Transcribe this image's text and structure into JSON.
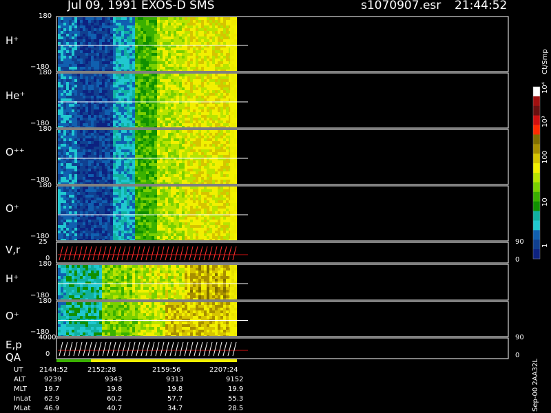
{
  "header": {
    "title": "Jul 09, 1991    EXOS-D SMS",
    "file": "s1070907.esr",
    "time": "21:44:52"
  },
  "colorbar": {
    "title": "Ct/Smp",
    "labels": [
      "10⁴",
      "10³",
      "100",
      "10",
      "1"
    ],
    "colors": [
      "#ffffff",
      "#a01010",
      "#6a1010",
      "#d01010",
      "#ff2a00",
      "#806e00",
      "#a88f00",
      "#d6c400",
      "#f2f000",
      "#b8e400",
      "#7ad000",
      "#3ab000",
      "#109000",
      "#10b0a0",
      "#20c8d0",
      "#1060b0",
      "#104090",
      "#0d2280"
    ]
  },
  "side_label": "Sep-00  2AA32L",
  "chart_data": [
    {
      "type": "heatmap",
      "title": "H⁺",
      "ylim": [
        -180,
        180
      ],
      "yticks": [
        "180",
        "−180"
      ],
      "line_value": 0
    },
    {
      "type": "heatmap",
      "title": "He⁺",
      "ylim": [
        -180,
        180
      ],
      "yticks": [
        "180",
        "−180"
      ],
      "line_value": 0
    },
    {
      "type": "heatmap",
      "title": "O⁺⁺",
      "ylim": [
        -180,
        180
      ],
      "yticks": [
        "180",
        "−180"
      ],
      "line_value": 0
    },
    {
      "type": "heatmap",
      "title": "O⁺",
      "ylim": [
        -180,
        180
      ],
      "yticks": [
        "180",
        "−180"
      ],
      "line_value": 0
    },
    {
      "type": "line",
      "title": "V,r",
      "ylim": [
        0,
        25
      ],
      "yticks": [
        "25",
        "0"
      ],
      "right_ticks": [
        "90",
        "0"
      ]
    },
    {
      "type": "heatmap",
      "title": "H⁺",
      "ylim": [
        -180,
        180
      ],
      "yticks": [
        "180",
        "−180"
      ],
      "line_value": 0
    },
    {
      "type": "heatmap",
      "title": "O⁺",
      "ylim": [
        -180,
        180
      ],
      "yticks": [
        "180",
        "−180"
      ],
      "line_value": 0
    },
    {
      "type": "line",
      "title": "E,p",
      "ylim": [
        0,
        4000
      ],
      "yticks": [
        "4000",
        "0"
      ],
      "right_ticks": [
        "90",
        "0"
      ]
    }
  ],
  "qa_label": "QA",
  "footer": {
    "labels": [
      "UT",
      "ALT",
      "MLT",
      "InLat",
      "MLat"
    ],
    "columns": [
      [
        "2144:52",
        "9239",
        "19.7",
        "62.9",
        "46.9"
      ],
      [
        "2152:28",
        "9343",
        "19.8",
        "60.2",
        "40.7"
      ],
      [
        "2159:56",
        "9313",
        "19.8",
        "57.7",
        "34.7"
      ],
      [
        "2207:24",
        "9152",
        "19.9",
        "55.3",
        "28.5"
      ]
    ]
  }
}
